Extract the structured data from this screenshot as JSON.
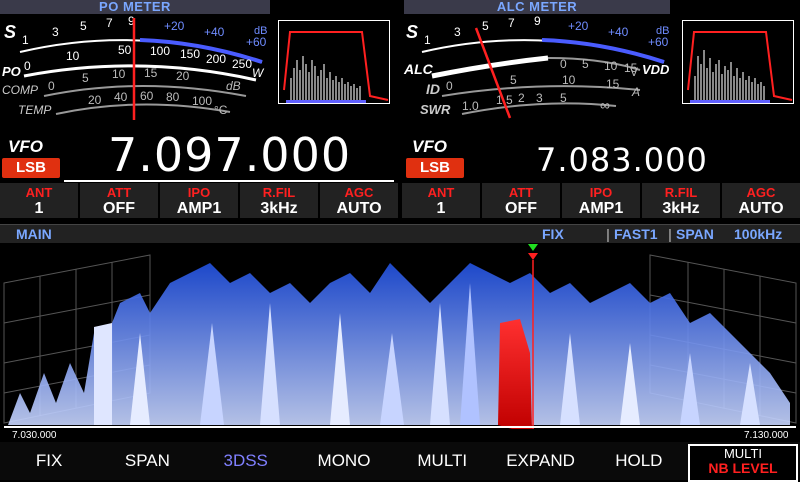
{
  "po_meter": {
    "title": "PO METER",
    "labels": [
      "S",
      "PO",
      "COMP",
      "TEMP"
    ],
    "s_ticks": [
      "1",
      "3",
      "5",
      "7",
      "9",
      "+20",
      "+40",
      "+60"
    ],
    "s_unit": "dB",
    "po_ticks": [
      "0",
      "10",
      "50",
      "100",
      "150",
      "200",
      "250"
    ],
    "po_unit": "W",
    "comp_ticks": [
      "0",
      "5",
      "10",
      "15",
      "20"
    ],
    "comp_unit": "dB",
    "temp_ticks": [
      "20",
      "40",
      "60",
      "80",
      "100"
    ],
    "temp_unit": "°C"
  },
  "alc_meter": {
    "title": "ALC METER",
    "labels": [
      "S",
      "ALC",
      "ID",
      "SWR"
    ],
    "s_ticks": [
      "1",
      "3",
      "5",
      "7",
      "9",
      "+20",
      "+40",
      "+60"
    ],
    "s_unit": "dB",
    "vdd_ticks": [
      "0",
      "5",
      "10",
      "15"
    ],
    "vdd_label": "VDD",
    "vdd_unit": "V",
    "id_ticks": [
      "0",
      "5",
      "10",
      "15"
    ],
    "id_unit": "A",
    "swr_ticks": [
      "1.0",
      "1.5",
      "2",
      "3",
      "5",
      "∞"
    ]
  },
  "vfo_main": {
    "label": "VFO",
    "mode": "LSB",
    "frequency": "7.097.000"
  },
  "vfo_sub": {
    "label": "VFO",
    "mode": "LSB",
    "frequency": "7.083.000"
  },
  "status_main": [
    {
      "label": "ANT",
      "value": "1"
    },
    {
      "label": "ATT",
      "value": "OFF"
    },
    {
      "label": "IPO",
      "value": "AMP1"
    },
    {
      "label": "R.FIL",
      "value": "3kHz"
    },
    {
      "label": "AGC",
      "value": "AUTO"
    }
  ],
  "status_sub": [
    {
      "label": "ANT",
      "value": "1"
    },
    {
      "label": "ATT",
      "value": "OFF"
    },
    {
      "label": "IPO",
      "value": "AMP1"
    },
    {
      "label": "R.FIL",
      "value": "3kHz"
    },
    {
      "label": "AGC",
      "value": "AUTO"
    }
  ],
  "scope": {
    "band_label": "MAIN",
    "mode": "FIX",
    "speed": "FAST1",
    "span_label": "SPAN",
    "span_value": "100kHz",
    "freq_left": "7.030.000",
    "freq_right": "7.130.000"
  },
  "softkeys": [
    {
      "label": "FIX",
      "active": false
    },
    {
      "label": "SPAN",
      "active": false
    },
    {
      "label": "3DSS",
      "active": true
    },
    {
      "label": "MONO",
      "active": false
    },
    {
      "label": "MULTI",
      "active": false
    },
    {
      "label": "EXPAND",
      "active": false
    },
    {
      "label": "HOLD",
      "active": false
    }
  ],
  "multi_button": {
    "line1": "MULTI",
    "line2": "NB LEVEL"
  },
  "colors": {
    "accent_blue": "#7aa7ff",
    "mode_red": "#e03010",
    "label_red": "#ff2020",
    "needle": "#ff2020"
  }
}
